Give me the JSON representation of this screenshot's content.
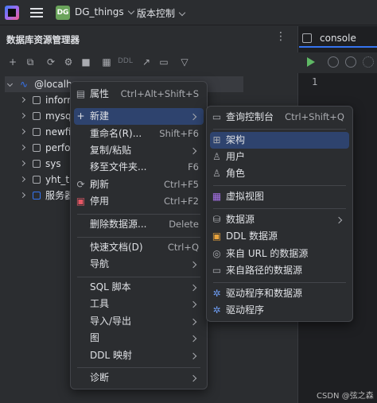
{
  "topbar": {
    "project_badge": "DG",
    "project_name": "DG_things",
    "vcs_label": "版本控制"
  },
  "panel": {
    "title": "数据库资源管理器",
    "more": "⋮",
    "ddl_label": "DDL"
  },
  "tree": {
    "root": "@localho",
    "items": [
      "inforr",
      "mysq",
      "newfi",
      "perfo",
      "sys",
      "yht_th",
      "服务器"
    ]
  },
  "editor": {
    "tab_label": "console",
    "line_number": "1"
  },
  "context_menu": {
    "items": [
      {
        "label": "属性",
        "shortcut": "Ctrl+Alt+Shift+S"
      },
      {
        "label": "新建",
        "shortcut": ""
      },
      {
        "label": "重命名(R)...",
        "shortcut": "Shift+F6"
      },
      {
        "label": "复制/粘贴",
        "shortcut": ""
      },
      {
        "label": "移至文件夹...",
        "shortcut": "F6"
      },
      {
        "label": "刷新",
        "shortcut": "Ctrl+F5"
      },
      {
        "label": "停用",
        "shortcut": "Ctrl+F2"
      },
      {
        "label": "删除数据源...",
        "shortcut": "Delete"
      },
      {
        "label": "快速文档(D)",
        "shortcut": "Ctrl+Q"
      },
      {
        "label": "导航",
        "shortcut": ""
      },
      {
        "label": "SQL 脚本",
        "shortcut": ""
      },
      {
        "label": "工具",
        "shortcut": ""
      },
      {
        "label": "导入/导出",
        "shortcut": ""
      },
      {
        "label": "图",
        "shortcut": ""
      },
      {
        "label": "DDL 映射",
        "shortcut": ""
      },
      {
        "label": "诊断",
        "shortcut": ""
      }
    ]
  },
  "submenu": {
    "items": [
      {
        "label": "查询控制台",
        "shortcut": "Ctrl+Shift+Q"
      },
      {
        "label": "架构",
        "shortcut": ""
      },
      {
        "label": "用户",
        "shortcut": ""
      },
      {
        "label": "角色",
        "shortcut": ""
      },
      {
        "label": "虚拟视图",
        "shortcut": ""
      },
      {
        "label": "数据源",
        "shortcut": ""
      },
      {
        "label": "DDL 数据源",
        "shortcut": ""
      },
      {
        "label": "来自 URL 的数据源",
        "shortcut": ""
      },
      {
        "label": "来自路径的数据源",
        "shortcut": ""
      },
      {
        "label": "驱动程序和数据源",
        "shortcut": ""
      },
      {
        "label": "驱动程序",
        "shortcut": ""
      }
    ]
  },
  "watermark": "CSDN @弦之森",
  "colors": {
    "highlight": "#2e436e",
    "accent": "#3574f0",
    "run_green": "#5fb865",
    "badge_green": "#6aa35b"
  }
}
